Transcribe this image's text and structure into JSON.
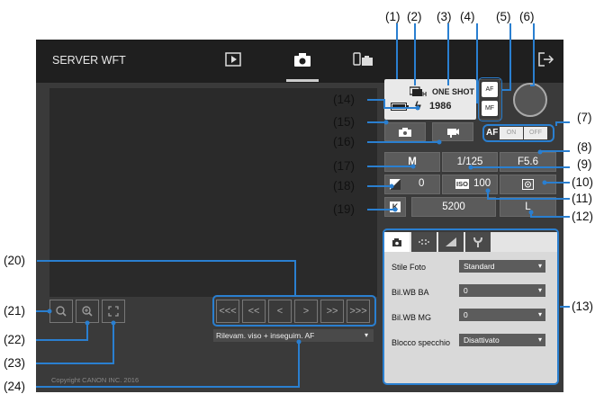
{
  "callouts": [
    "(1)",
    "(2)",
    "(3)",
    "(4)",
    "(5)",
    "(6)",
    "(7)",
    "(8)",
    "(9)",
    "(10)",
    "(11)",
    "(12)",
    "(13)",
    "(14)",
    "(15)",
    "(16)",
    "(17)",
    "(18)",
    "(19)",
    "(20)",
    "(21)",
    "(22)",
    "(23)",
    "(24)"
  ],
  "app": {
    "title": "SERVER WFT",
    "copyright": "Copyright CANON INC. 2016"
  },
  "status": {
    "drive": "□H",
    "af_mode": "ONE SHOT",
    "shots": "1986"
  },
  "focus": {
    "af": "AF",
    "mf": "MF"
  },
  "af_toggle": {
    "label": "AF",
    "on": "ON",
    "off": "OFF"
  },
  "exposure": {
    "aperture": "F5.6",
    "mode": "M",
    "shutter": "1/125",
    "comp": "0",
    "iso_label": "ISO",
    "iso": "100",
    "kelvin_label": "K",
    "kelvin": "5200",
    "quality": "L"
  },
  "nav": [
    "<<<",
    "<<",
    "<",
    ">",
    ">>",
    ">>>"
  ],
  "af_method": "Rilevam. viso + inseguim. AF",
  "settings": [
    {
      "label": "Stile Foto",
      "value": "Standard"
    },
    {
      "label": "Bil.WB BA",
      "value": "0"
    },
    {
      "label": "Bil.WB MG",
      "value": "0"
    },
    {
      "label": "Blocco specchio",
      "value": "Disattivato"
    }
  ],
  "colors": {
    "accent": "#2a7fd0",
    "panel": "#3a3a3a",
    "topbar": "#1f1f1f"
  }
}
